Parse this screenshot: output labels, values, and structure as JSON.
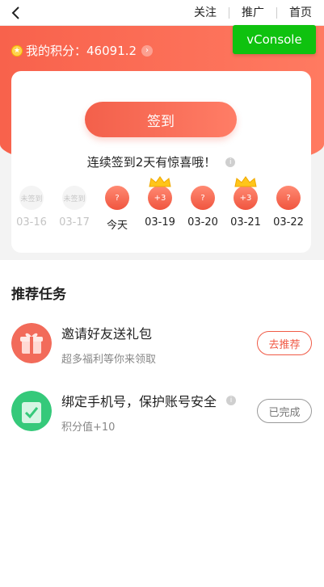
{
  "nav": {
    "links": [
      "关注",
      "推广",
      "首页"
    ]
  },
  "points": {
    "label": "我的积分：",
    "value": "46091.2"
  },
  "vconsole_label": "vConsole",
  "signin": {
    "button_label": "签到",
    "streak_text": "连续签到2天有惊喜哦！"
  },
  "days": [
    {
      "status": "missed",
      "bubble": "未签到",
      "date": "03-16"
    },
    {
      "status": "missed",
      "bubble": "未签到",
      "date": "03-17"
    },
    {
      "status": "today",
      "bubble": "?",
      "date": "今天"
    },
    {
      "status": "bonus",
      "bubble": "+3",
      "date": "03-19"
    },
    {
      "status": "future",
      "bubble": "?",
      "date": "03-20"
    },
    {
      "status": "bonus",
      "bubble": "+3",
      "date": "03-21"
    },
    {
      "status": "future",
      "bubble": "?",
      "date": "03-22"
    }
  ],
  "tasks": {
    "section_title": "推荐任务",
    "items": [
      {
        "title": "邀请好友送礼包",
        "subtitle": "超多福利等你来领取",
        "button": "去推荐",
        "icon": "gift-icon"
      },
      {
        "title": "绑定手机号，保护账号安全",
        "subtitle": "积分值+10",
        "button": "已完成",
        "icon": "check-icon"
      }
    ]
  },
  "colors": {
    "accent": "#f3604b",
    "vconsole": "#0fc20f",
    "gift_green": "#2ecc71"
  }
}
